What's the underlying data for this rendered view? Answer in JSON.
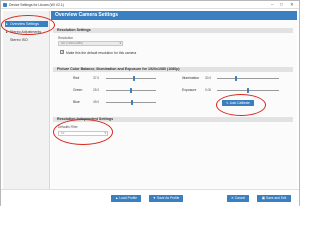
{
  "window": {
    "title": "Device Settings for Lbcam (WI V2.1)",
    "minimize_glyph": "–",
    "maximize_glyph": "□",
    "close_glyph": "✕"
  },
  "sidebar": {
    "items": [
      {
        "label": "Overview Settings",
        "glyph": "▸",
        "active": true
      },
      {
        "label": "Stereo Adjustments",
        "glyph": "▸",
        "active": false
      },
      {
        "label": "Stereo ISO",
        "glyph": "",
        "active": false
      }
    ]
  },
  "page": {
    "title": "Overview Camera Settings"
  },
  "resolution_settings": {
    "header": "Resolution Settings",
    "resolution_label": "Resolution",
    "resolution_value": "HD (1920x1080)",
    "dropdown_arrow": "▾",
    "checkbox_label": "Make this the default resolution for this camera",
    "checkbox_checked": true
  },
  "color_balance": {
    "header": "Picture Color Balance, Illumination and Exposure for 1920x1080 (1080p)",
    "sliders": {
      "red": {
        "label": "Red",
        "value": "37.0",
        "level": 0.55
      },
      "green": {
        "label": "Green",
        "value": "25.0",
        "level": 0.5
      },
      "blue": {
        "label": "Blue",
        "value": "49.0",
        "level": 0.52
      },
      "illumination": {
        "label": "Illumination",
        "value": "30.0",
        "level": 0.3
      },
      "exposure": {
        "label": "Exposure",
        "value": "0.00",
        "level": 0.5
      }
    },
    "auto_button": "Auto Calibrate",
    "auto_glyph": "✎"
  },
  "resolution_independent": {
    "header": "Resolution Independent Settings",
    "filter_label": "Defaults Filter",
    "filter_value": "10",
    "dropdown_arrow": "▾"
  },
  "footer": {
    "load_profile": "Load Profile",
    "save_as_profile": "Save As Profile",
    "cancel": "Cancel",
    "save_and_exit": "Save and Exit",
    "load_glyph": "▲",
    "save_as_glyph": "▼",
    "cancel_glyph": "✕",
    "save_glyph": "▣"
  },
  "colors": {
    "accent": "#3a7fc0",
    "highlight": "#d9281f",
    "section_bg": "#e2e2e2",
    "sidebar_bg": "#f2f2f2"
  }
}
